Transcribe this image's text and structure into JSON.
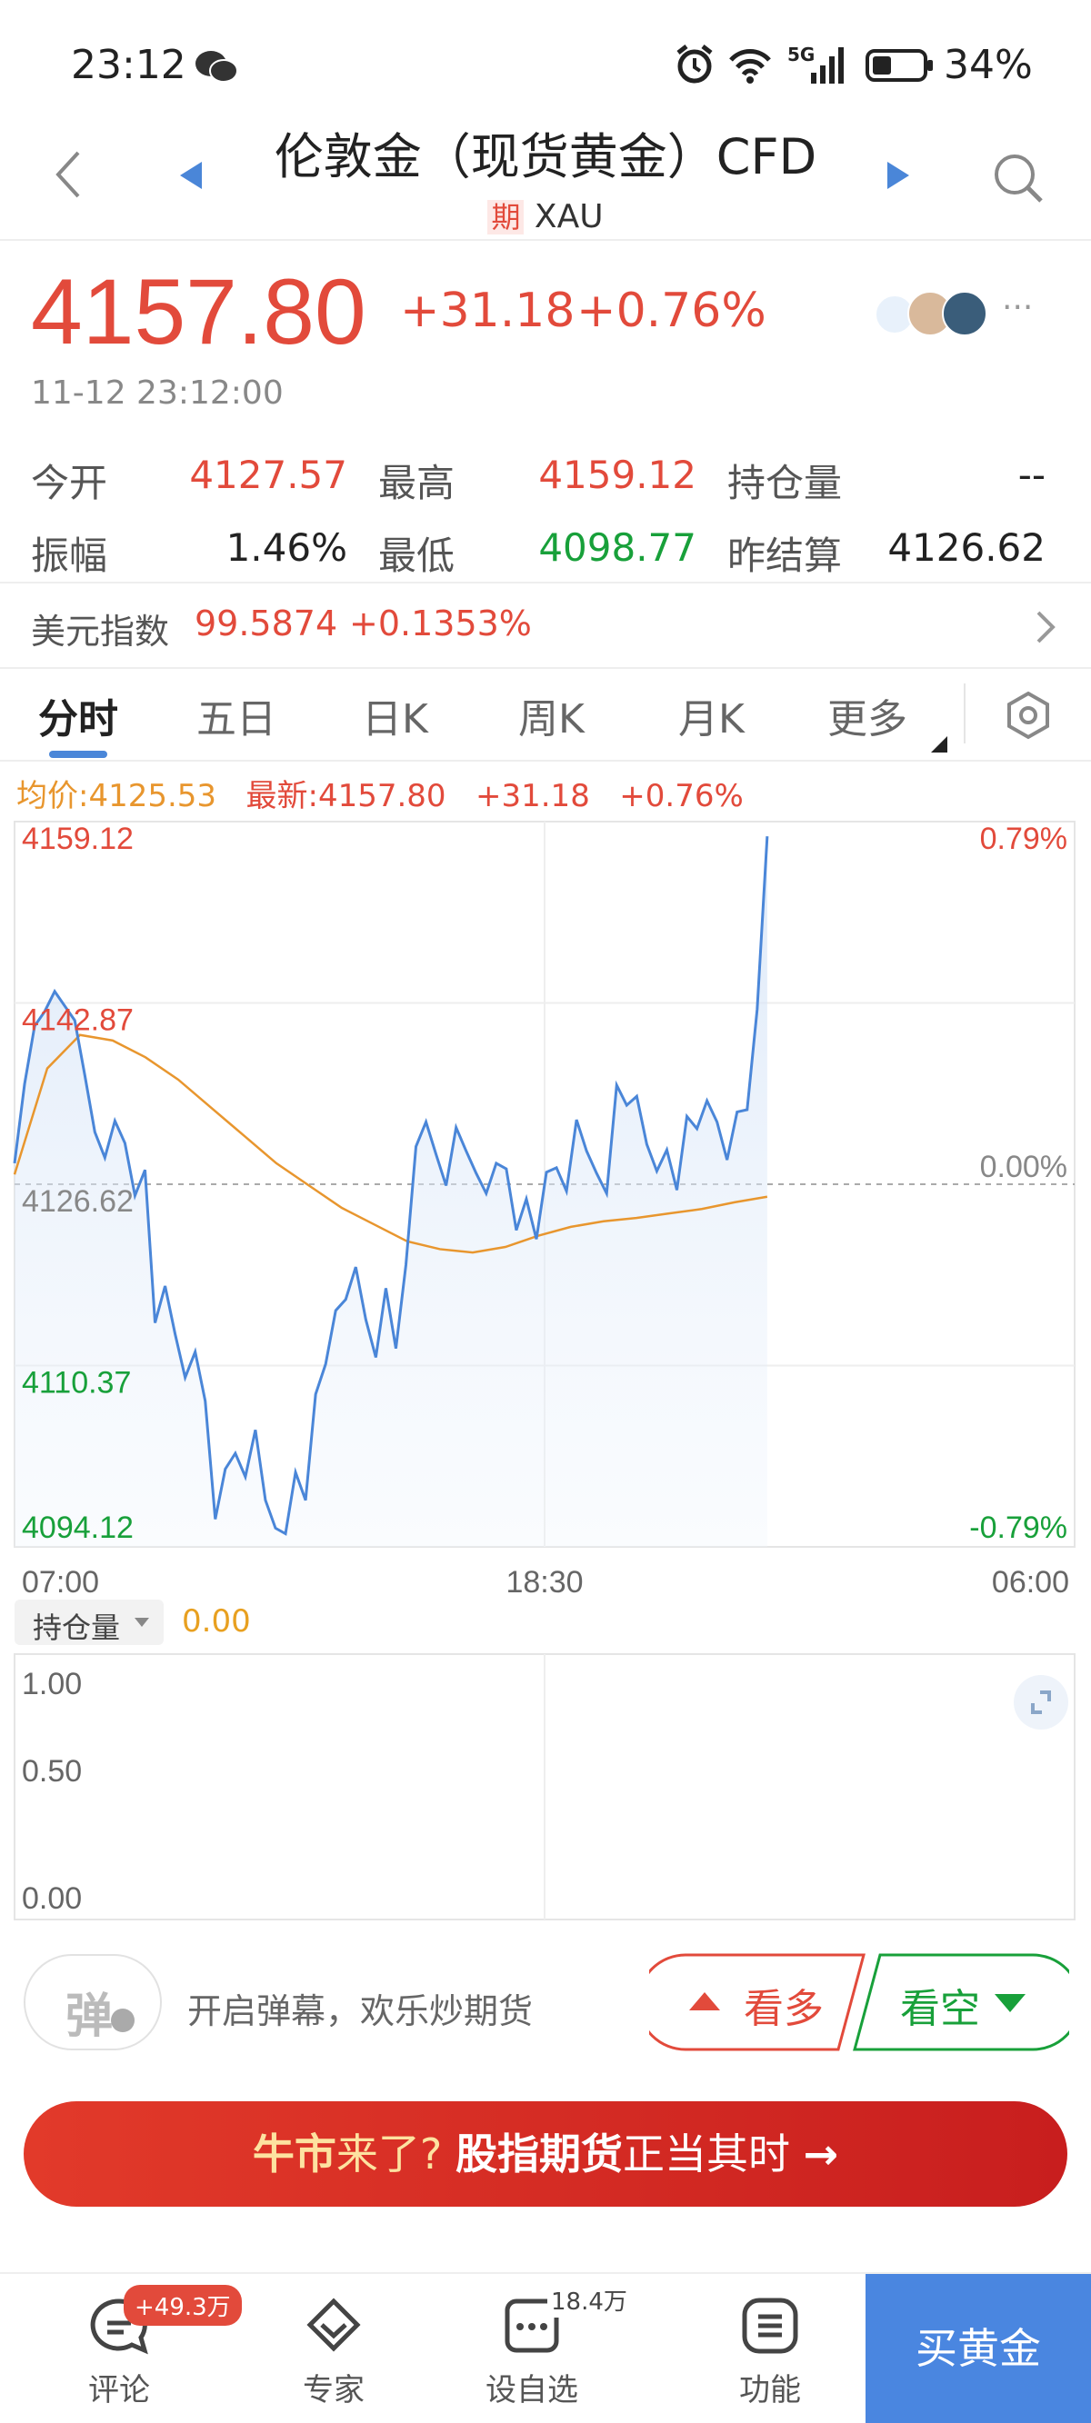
{
  "status": {
    "time": "23:12",
    "battery": "34%",
    "network": "5G"
  },
  "header": {
    "title": "伦敦金（现货黄金）CFD",
    "badge": "期",
    "code": "XAU"
  },
  "quote": {
    "price": "4157.80",
    "change": "+31.18",
    "change_pct": "+0.76%",
    "datetime": "11-12 23:12:00",
    "stats": [
      {
        "label": "今开",
        "value": "4127.57",
        "color": "red"
      },
      {
        "label": "最高",
        "value": "4159.12",
        "color": "red"
      },
      {
        "label": "持仓量",
        "value": "--",
        "color": "dark"
      },
      {
        "label": "振幅",
        "value": "1.46%",
        "color": "dark"
      },
      {
        "label": "最低",
        "value": "4098.77",
        "color": "green"
      },
      {
        "label": "昨结算",
        "value": "4126.62",
        "color": "dark"
      }
    ]
  },
  "dollar_index": {
    "label": "美元指数",
    "value": "99.5874",
    "change": "+0.1353%"
  },
  "tabs": [
    "分时",
    "五日",
    "日K",
    "周K",
    "月K",
    "更多"
  ],
  "chart_legend": {
    "avg": "均价:4125.53",
    "latest": "最新:4157.80",
    "change": "+31.18",
    "pct": "+0.76%"
  },
  "chart_data": {
    "type": "line",
    "x_ticks": [
      "07:00",
      "18:30",
      "06:00"
    ],
    "y_ticks": [
      "4159.12",
      "4142.87",
      "4126.62",
      "4110.37",
      "4094.12"
    ],
    "pct_ticks": [
      "0.79%",
      "0.00%",
      "-0.79%"
    ],
    "ylim": [
      4094.12,
      4159.12
    ],
    "reference": 4126.62,
    "session_fraction": [
      0,
      0.71
    ],
    "series": [
      {
        "role": "price",
        "color": "#4a86d8",
        "values": [
          4128.5,
          4135.6,
          4140.8,
          4142.1,
          4143.9,
          4142.6,
          4141.3,
          4136.4,
          4131.3,
          4129.0,
          4132.3,
          4130.3,
          4125.6,
          4127.9,
          4114.2,
          4117.5,
          4113.2,
          4109.3,
          4111.6,
          4107.2,
          4096.6,
          4101.1,
          4102.5,
          4100.4,
          4104.6,
          4098.3,
          4095.8,
          4095.3,
          4100.8,
          4098.3,
          4107.8,
          4110.5,
          4115.3,
          4116.3,
          4119.2,
          4114.5,
          4111.1,
          4117.3,
          4111.9,
          4119.4,
          4130.0,
          4132.2,
          4129.3,
          4126.5,
          4131.7,
          4129.6,
          4127.6,
          4125.8,
          4128.5,
          4128.0,
          4122.5,
          4125.3,
          4121.7,
          4127.7,
          4128.1,
          4126.0,
          4132.4,
          4129.6,
          4127.6,
          4125.8,
          4135.5,
          4133.7,
          4134.5,
          4130.2,
          4127.8,
          4129.7,
          4126.1,
          4132.7,
          4131.6,
          4134.1,
          4132.2,
          4128.8,
          4133.1,
          4133.3,
          4142.3,
          4157.8
        ]
      },
      {
        "role": "average",
        "color": "#e8962e",
        "values": [
          4127.5,
          4137.0,
          4140.0,
          4139.5,
          4138.0,
          4136.0,
          4133.5,
          4131.0,
          4128.5,
          4126.5,
          4124.5,
          4123.0,
          4121.5,
          4120.8,
          4120.5,
          4121.0,
          4122.0,
          4122.8,
          4123.3,
          4123.6,
          4124.0,
          4124.4,
          4125.0,
          4125.5
        ]
      }
    ]
  },
  "open_interest": {
    "selector": "持仓量",
    "value": "0.00",
    "y_ticks": [
      "1.00",
      "0.50",
      "0.00"
    ]
  },
  "danmu": {
    "icon": "弹",
    "text": "开启弹幕，欢乐炒期货"
  },
  "trade": {
    "bull": "看多",
    "bear": "看空"
  },
  "banner": {
    "part1": "牛市",
    "part2": "来了?",
    "part3": "股指期货",
    "part4": "正当其时",
    "arrow": "→"
  },
  "nav": [
    {
      "label": "评论",
      "badge": "+49.3万",
      "icon": "comment-icon"
    },
    {
      "label": "专家",
      "badge": "",
      "icon": "expert-icon"
    },
    {
      "label": "设自选",
      "badge": "18.4万",
      "icon": "watchlist-icon"
    },
    {
      "label": "功能",
      "badge": "",
      "icon": "menu-icon"
    }
  ],
  "buy_button": "买黄金",
  "colors": {
    "up": "#e24a3b",
    "down": "#18a03a",
    "accent": "#4a86d8",
    "avg": "#e8962e"
  }
}
